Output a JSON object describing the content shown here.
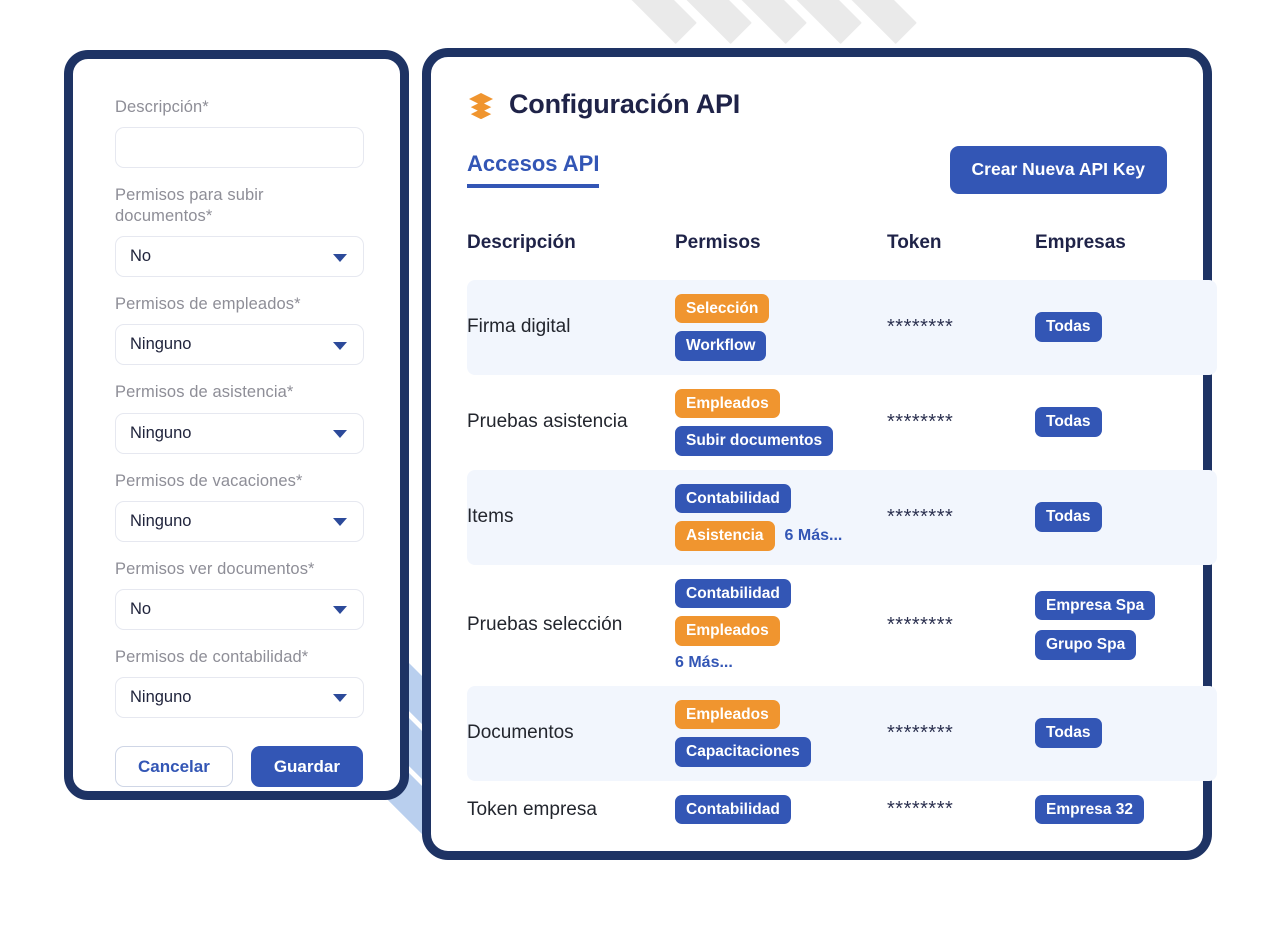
{
  "form": {
    "fields": [
      {
        "label": "Descripción*",
        "type": "text",
        "value": "",
        "placeholder": ""
      },
      {
        "label": "Permisos para subir documentos*",
        "type": "select",
        "value": "No"
      },
      {
        "label": "Permisos de empleados*",
        "type": "select",
        "value": "Ninguno"
      },
      {
        "label": "Permisos de asistencia*",
        "type": "select",
        "value": "Ninguno"
      },
      {
        "label": "Permisos de vacaciones*",
        "type": "select",
        "value": "Ninguno"
      },
      {
        "label": "Permisos ver documentos*",
        "type": "select",
        "value": "No"
      },
      {
        "label": "Permisos de contabilidad*",
        "type": "select",
        "value": "Ninguno"
      }
    ],
    "cancel_label": "Cancelar",
    "save_label": "Guardar"
  },
  "api": {
    "icon": "layer-stack-icon",
    "title": "Configuración API",
    "tab_label": "Accesos API",
    "create_button_label": "Crear Nueva API Key",
    "columns": [
      "Descripción",
      "Permisos",
      "Token",
      "Empresas"
    ],
    "rows": [
      {
        "description": "Firma digital",
        "permissions": [
          {
            "label": "Selección",
            "color": "orange"
          },
          {
            "label": "Workflow",
            "color": "blue"
          }
        ],
        "more": "",
        "token": "********",
        "companies": [
          "Todas"
        ]
      },
      {
        "description": "Pruebas asistencia",
        "permissions": [
          {
            "label": "Empleados",
            "color": "orange"
          },
          {
            "label": "Subir documentos",
            "color": "blue"
          }
        ],
        "more": "",
        "token": "********",
        "companies": [
          "Todas"
        ]
      },
      {
        "description": "Items",
        "permissions": [
          {
            "label": "Contabilidad",
            "color": "blue"
          },
          {
            "label": "Asistencia",
            "color": "orange"
          }
        ],
        "more": "6 Más...",
        "more_inline": true,
        "token": "********",
        "companies": [
          "Todas"
        ]
      },
      {
        "description": "Pruebas selección",
        "permissions": [
          {
            "label": "Contabilidad",
            "color": "blue"
          },
          {
            "label": "Empleados",
            "color": "orange"
          }
        ],
        "more": "6 Más...",
        "more_inline": false,
        "token": "********",
        "companies": [
          "Empresa Spa",
          "Grupo Spa"
        ]
      },
      {
        "description": "Documentos",
        "permissions": [
          {
            "label": "Empleados",
            "color": "orange"
          },
          {
            "label": "Capacitaciones",
            "color": "blue"
          }
        ],
        "more": "",
        "token": "********",
        "companies": [
          "Todas"
        ]
      },
      {
        "description": "Token empresa",
        "permissions": [
          {
            "label": "Contabilidad",
            "color": "blue"
          }
        ],
        "more": "",
        "token": "********",
        "companies": [
          "Empresa 32"
        ]
      }
    ]
  },
  "colors": {
    "accent_blue": "#3356b5",
    "accent_orange": "#f0952f",
    "frame_navy": "#1e3364",
    "row_alt_bg": "#f2f6fd",
    "stripe_blue": "#b9cfee"
  }
}
